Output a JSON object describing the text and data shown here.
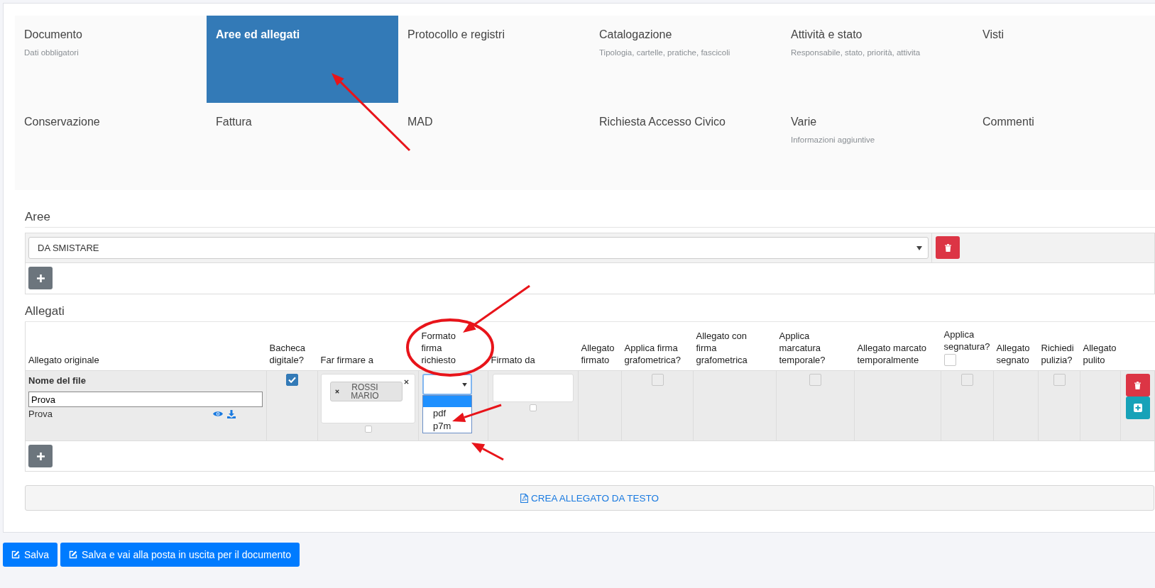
{
  "tabs": [
    {
      "title": "Documento",
      "subtitle": "Dati obbligatori",
      "selected": false
    },
    {
      "title": "Aree ed allegati",
      "selected": true
    },
    {
      "title": "Protocollo e registri",
      "selected": false
    },
    {
      "title": "Catalogazione",
      "subtitle": "Tipologia, cartelle, pratiche, fascicoli",
      "selected": false
    },
    {
      "title": "Attività e stato",
      "subtitle": "Responsabile, stato, priorità, attivita",
      "selected": false
    },
    {
      "title": "Visti",
      "selected": false
    },
    {
      "title": "Conservazione",
      "selected": false
    },
    {
      "title": "Fattura",
      "selected": false
    },
    {
      "title": "MAD",
      "selected": false
    },
    {
      "title": "Richiesta Accesso Civico",
      "selected": false
    },
    {
      "title": "Varie",
      "subtitle": "Informazioni aggiuntive",
      "selected": false
    },
    {
      "title": "Commenti",
      "selected": false
    }
  ],
  "aree": {
    "heading": "Aree",
    "rows": [
      {
        "value": "DA SMISTARE"
      }
    ]
  },
  "allegati": {
    "heading": "Allegati",
    "columns": [
      {
        "label": "Allegato originale"
      },
      {
        "label": "Bacheca digitale?"
      },
      {
        "label": "Far firmare a"
      },
      {
        "label": "Formato firma richiesto"
      },
      {
        "label": "Firmato da"
      },
      {
        "label": "Allegato firmato"
      },
      {
        "label": "Applica firma grafometrica?"
      },
      {
        "label": "Allegato con firma grafometrica"
      },
      {
        "label": "Applica marcatura temporale?"
      },
      {
        "label": "Allegato marcato temporalmente"
      },
      {
        "label": "Applica segnatura?",
        "checked": false
      },
      {
        "label": "Allegato segnato"
      },
      {
        "label": "Richiedi pulizia?"
      },
      {
        "label": "Allegato pulito"
      }
    ],
    "rows": [
      {
        "cells": [
          {
            "kind": "file",
            "label": "Nome del file",
            "value": "Prova",
            "file_name": "Prova"
          },
          {
            "kind": "check",
            "checked": true
          },
          {
            "kind": "signers",
            "tags": [
              "ROSSI MARIO"
            ],
            "checked": false
          },
          {
            "kind": "select",
            "expanded": true,
            "options": [
              {
                "label": "pdf",
                "selected": false
              },
              {
                "label": "p7m",
                "selected": false
              }
            ]
          },
          {
            "kind": "signed_by",
            "checked": false
          },
          {
            "kind": "empty"
          },
          {
            "kind": "check",
            "checked": false
          },
          {
            "kind": "empty"
          },
          {
            "kind": "check",
            "checked": false
          },
          {
            "kind": "empty"
          },
          {
            "kind": "check",
            "checked": false
          },
          {
            "kind": "empty"
          },
          {
            "kind": "check",
            "checked": false
          },
          {
            "kind": "empty"
          },
          {
            "kind": "actions"
          }
        ]
      }
    ]
  },
  "create_button": "CREA ALLEGATO DA TESTO",
  "buttons": [
    "Salva",
    "Salva e vai alla posta in uscita per il documento"
  ]
}
